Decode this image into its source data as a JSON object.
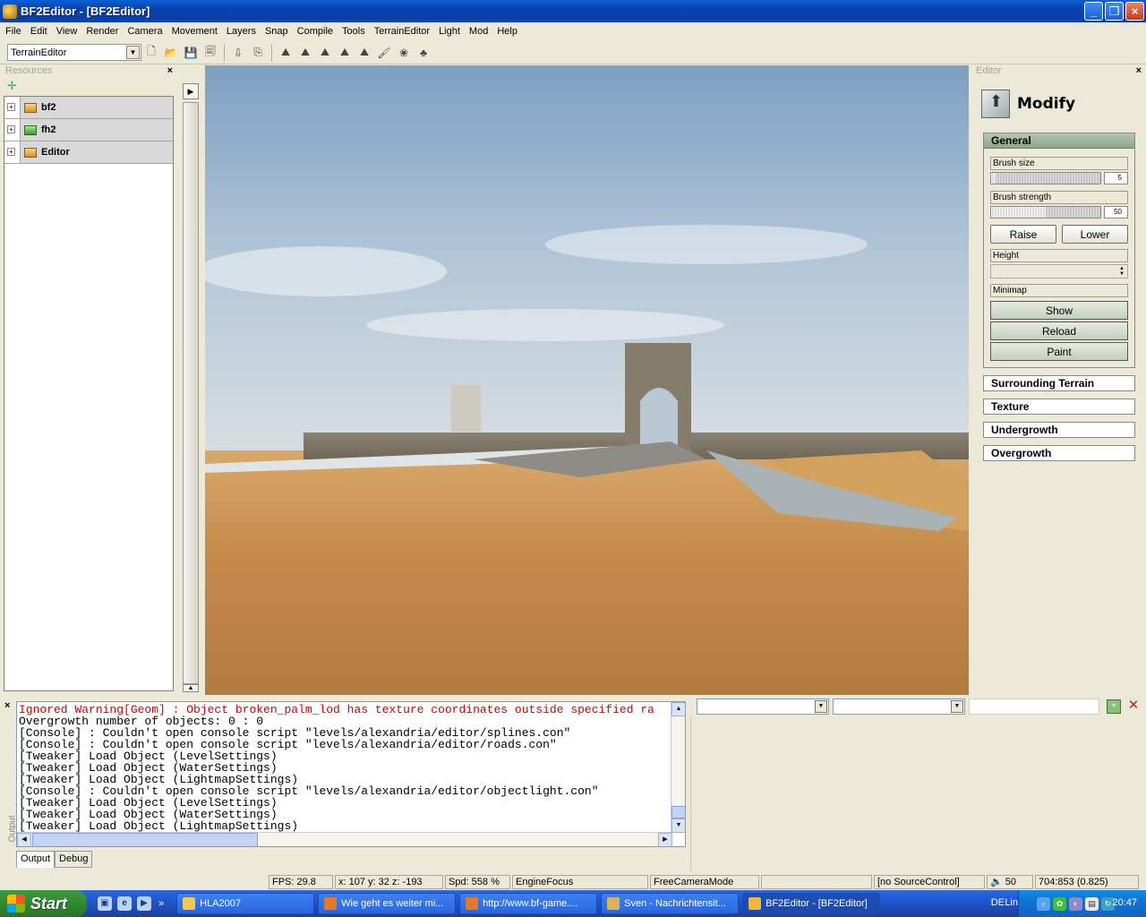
{
  "window": {
    "title": "BF2Editor - [BF2Editor]",
    "minimize": "_",
    "restore": "❐",
    "close": "×"
  },
  "menu": [
    "File",
    "Edit",
    "View",
    "Render",
    "Camera",
    "Movement",
    "Layers",
    "Snap",
    "Compile",
    "Tools",
    "TerrainEditor",
    "Light",
    "Mod",
    "Help"
  ],
  "toolbar": {
    "mode_select": "TerrainEditor"
  },
  "resources": {
    "title": "Resources",
    "close": "×",
    "add": "✛",
    "items": [
      {
        "name": "bf2",
        "icon": "folder-icon",
        "expand": "+"
      },
      {
        "name": "fh2",
        "icon": "folder-green-icon",
        "expand": "+"
      },
      {
        "name": "Editor",
        "icon": "folder-icon",
        "expand": "+"
      }
    ]
  },
  "editor": {
    "title": "Editor",
    "close": "×",
    "heading": "Modify",
    "general": {
      "title": "General",
      "brush_size_label": "Brush size",
      "brush_size_value": "5",
      "brush_size_fraction": 0.04,
      "brush_strength_label": "Brush strength",
      "brush_strength_value": "50",
      "brush_strength_fraction": 0.5,
      "raise": "Raise",
      "lower": "Lower",
      "height_label": "Height",
      "minimap_label": "Minimap",
      "show": "Show",
      "reload": "Reload",
      "paint": "Paint"
    },
    "sections": [
      "Surrounding Terrain",
      "Texture",
      "Undergrowth",
      "Overgrowth"
    ]
  },
  "output": {
    "close": "×",
    "side_label": "Output",
    "lines": [
      {
        "text": "Ignored Warning[Geom] : Object broken_palm_lod has texture coordinates outside specified ra",
        "warn": true
      },
      {
        "text": "Overgrowth number of objects: 0 : 0",
        "warn": false
      },
      {
        "text": "[Console] : Couldn't open console script \"levels/alexandria/editor/splines.con\"",
        "warn": false
      },
      {
        "text": "[Console] : Couldn't open console script \"levels/alexandria/editor/roads.con\"",
        "warn": false
      },
      {
        "text": "[Tweaker] Load Object (LevelSettings)",
        "warn": false
      },
      {
        "text": "[Tweaker] Load Object (WaterSettings)",
        "warn": false
      },
      {
        "text": "[Tweaker] Load Object (LightmapSettings)",
        "warn": false
      },
      {
        "text": "[Console] : Couldn't open console script \"levels/alexandria/editor/objectlight.con\"",
        "warn": false
      },
      {
        "text": "[Tweaker] Load Object (LevelSettings)",
        "warn": false
      },
      {
        "text": "[Tweaker] Load Object (WaterSettings)",
        "warn": false
      },
      {
        "text": "[Tweaker] Load Object (LightmapSettings)",
        "warn": false
      }
    ],
    "tabs": [
      "Output",
      "Debug"
    ]
  },
  "status": {
    "fps": "FPS: 29.8",
    "coords": "x: 107 y: 32 z: -193",
    "speed": "Spd: 558 %",
    "focus": "EngineFocus",
    "camera": "FreeCameraMode",
    "empty": "",
    "source": "[no SourceControl]",
    "volume": "50",
    "resolution": "704:853 (0.825)"
  },
  "taskbar": {
    "start": "Start",
    "chevron": "»",
    "tasks": [
      {
        "label": "HLA2007",
        "icon_color": "#f2c94c"
      },
      {
        "label": "Wie geht es weiter mi...",
        "icon_color": "#e8772e"
      },
      {
        "label": "http://www.bf-game....",
        "icon_color": "#e8772e"
      },
      {
        "label": "Sven - Nachrichtensit...",
        "icon_color": "#d9b35a"
      },
      {
        "label": "BF2Editor - [BF2Editor]",
        "icon_color": "#f2b63c"
      }
    ],
    "lang": "DE",
    "links": "Links",
    "clock": "20:47"
  },
  "colors": {
    "title_bar": "#0a4ab8",
    "taskbar": "#245edb",
    "warning_text": "#d40000",
    "panel_bg": "#ece9d8"
  }
}
